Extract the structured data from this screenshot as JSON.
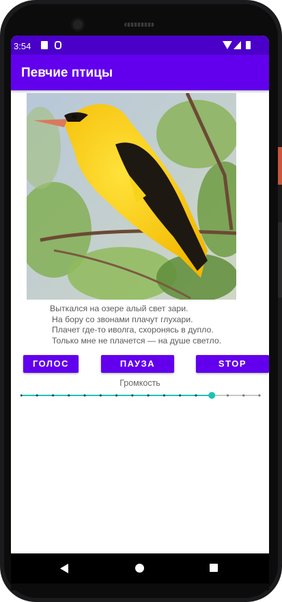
{
  "status_bar": {
    "time": "3:54",
    "icons": [
      "sd-card-icon",
      "sync-icon",
      "wifi-icon",
      "signal-icon",
      "battery-icon"
    ]
  },
  "app_bar": {
    "title": "Певчие птицы"
  },
  "image": {
    "subject": "yellow-bird-on-branch"
  },
  "poem": {
    "lines": [
      "Выткался на озере алый свет зари.",
      "На бору со звонами плачут глухари.",
      "Плачет где-то иволга, схоронясь в дупло.",
      "Только мне не плачется — на душе светло."
    ]
  },
  "buttons": {
    "voice": "ГОЛОС",
    "pause": "ПАУЗА",
    "stop": "STOP"
  },
  "volume": {
    "label": "Громкость",
    "steps": 16,
    "value_index": 12
  },
  "colors": {
    "primary": "#6200ee",
    "status_bar": "#4a00c8",
    "slider_accent": "#19c2b8"
  },
  "nav_bar": {
    "icons": [
      "back-icon",
      "home-icon",
      "recents-icon"
    ]
  }
}
